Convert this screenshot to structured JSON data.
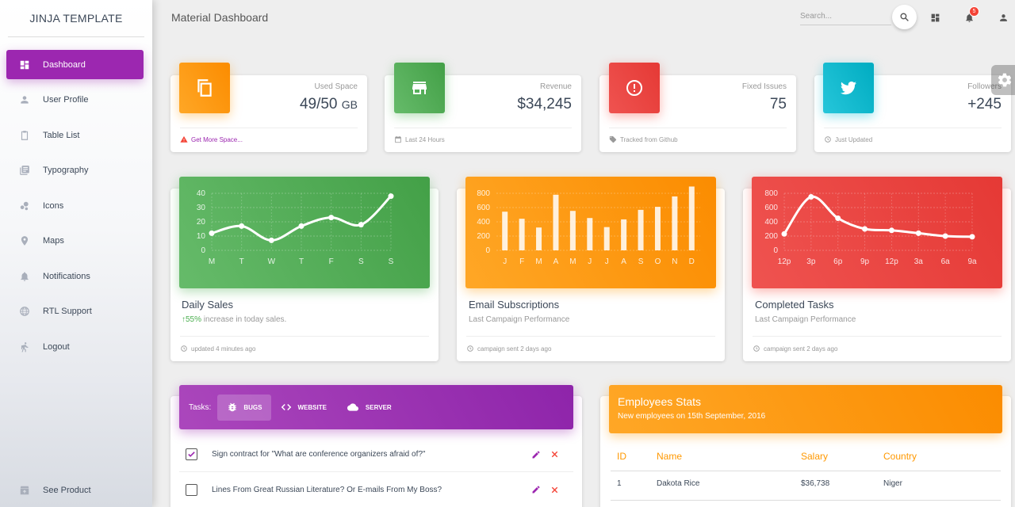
{
  "sidebar": {
    "brand": "JINJA TEMPLATE",
    "items": [
      {
        "label": "Dashboard",
        "icon": "dashboard-icon"
      },
      {
        "label": "User Profile",
        "icon": "person-icon"
      },
      {
        "label": "Table List",
        "icon": "clipboard-icon"
      },
      {
        "label": "Typography",
        "icon": "library-books-icon"
      },
      {
        "label": "Icons",
        "icon": "bubble-chart-icon"
      },
      {
        "label": "Maps",
        "icon": "location-icon"
      },
      {
        "label": "Notifications",
        "icon": "bell-icon"
      },
      {
        "label": "RTL Support",
        "icon": "language-icon"
      },
      {
        "label": "Logout",
        "icon": "running-person-icon"
      }
    ],
    "bottom_item": {
      "label": "See Product",
      "icon": "unarchive-icon"
    }
  },
  "topbar": {
    "title": "Material Dashboard",
    "search_placeholder": "Search...",
    "notification_count": "5"
  },
  "stats": [
    {
      "label": "Used Space",
      "value": "49/50",
      "unit": "GB",
      "footer": "Get More Space...",
      "color": "#ff9800"
    },
    {
      "label": "Revenue",
      "value": "$34,245",
      "unit": "",
      "footer": "Last 24 Hours",
      "color": "#4caf50"
    },
    {
      "label": "Fixed Issues",
      "value": "75",
      "unit": "",
      "footer": "Tracked from Github",
      "color": "#f44336"
    },
    {
      "label": "Followers",
      "value": "+245",
      "unit": "",
      "footer": "Just Updated",
      "color": "#00bcd4"
    }
  ],
  "charts": [
    {
      "title": "Daily Sales",
      "subtitle_pct": "55%",
      "subtitle_rest": " increase in today sales.",
      "footer": "updated 4 minutes ago"
    },
    {
      "title": "Email Subscriptions",
      "subtitle": "Last Campaign Performance",
      "footer": "campaign sent 2 days ago"
    },
    {
      "title": "Completed Tasks",
      "subtitle": "Last Campaign Performance",
      "footer": "campaign sent 2 days ago"
    }
  ],
  "chart_data": [
    {
      "type": "line",
      "categories": [
        "M",
        "T",
        "W",
        "T",
        "F",
        "S",
        "S"
      ],
      "values": [
        12,
        17,
        7,
        17,
        23,
        18,
        38
      ],
      "yticks": [
        "0",
        "10",
        "20",
        "30",
        "40"
      ],
      "ylim": [
        0,
        40
      ],
      "color": "#4caf50"
    },
    {
      "type": "bar",
      "categories": [
        "J",
        "F",
        "M",
        "A",
        "M",
        "J",
        "J",
        "A",
        "S",
        "O",
        "N",
        "D"
      ],
      "values": [
        542,
        443,
        320,
        780,
        553,
        453,
        326,
        434,
        568,
        610,
        756,
        895
      ],
      "yticks": [
        "0",
        "200",
        "400",
        "600",
        "800"
      ],
      "ylim": [
        0,
        800
      ],
      "color": "#ff9800"
    },
    {
      "type": "line",
      "categories": [
        "12p",
        "3p",
        "6p",
        "9p",
        "12p",
        "3a",
        "6a",
        "9a"
      ],
      "values": [
        230,
        750,
        450,
        300,
        280,
        240,
        200,
        190
      ],
      "yticks": [
        "0",
        "200",
        "400",
        "600",
        "800"
      ],
      "ylim": [
        0,
        800
      ],
      "color": "#f44336"
    }
  ],
  "tasks": {
    "label": "Tasks:",
    "tabs": [
      {
        "label": "BUGS",
        "icon": "bug-icon"
      },
      {
        "label": "WEBSITE",
        "icon": "code-icon"
      },
      {
        "label": "SERVER",
        "icon": "cloud-icon"
      }
    ],
    "rows": [
      {
        "text": "Sign contract for \"What are conference organizers afraid of?\"",
        "checked": true
      },
      {
        "text": "Lines From Great Russian Literature? Or E-mails From My Boss?",
        "checked": false
      }
    ]
  },
  "employees": {
    "title": "Employees Stats",
    "subtitle": "New employees on 15th September, 2016",
    "headers": [
      "ID",
      "Name",
      "Salary",
      "Country"
    ],
    "rows": [
      [
        "1",
        "Dakota Rice",
        "$36,738",
        "Niger"
      ]
    ]
  }
}
